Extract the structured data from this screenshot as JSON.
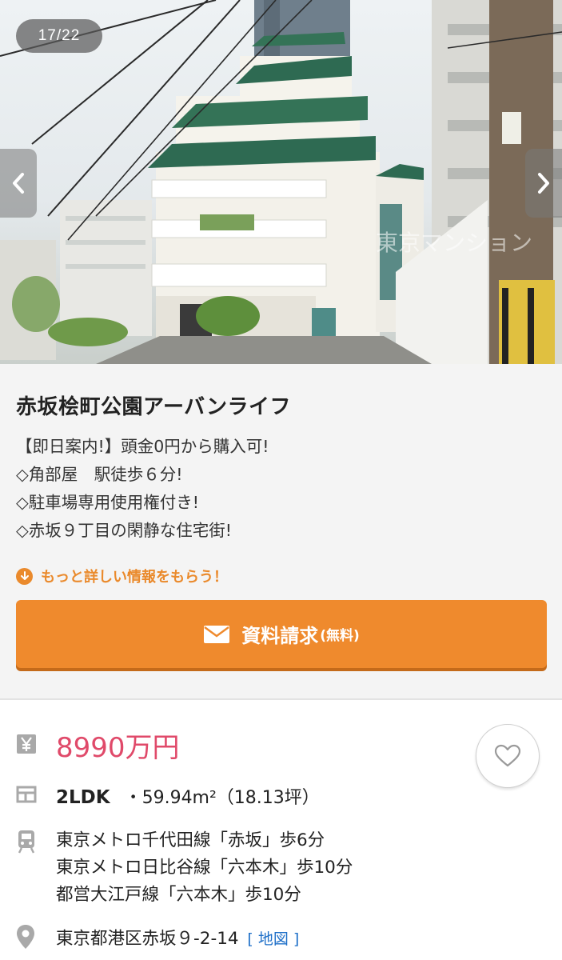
{
  "gallery": {
    "counter": "17/22",
    "watermark": "東京マンション",
    "prev_icon": "chevron-left-icon",
    "next_icon": "chevron-right-icon"
  },
  "listing": {
    "title": "赤坂桧町公園アーバンライフ",
    "description": [
      "【即日案内!】頭金0円から購入可!",
      "◇角部屋　駅徒歩６分!",
      "◇駐車場専用使用権付き!",
      "◇赤坂９丁目の閑静な住宅街!"
    ],
    "more_info_link": "もっと詳しい情報をもらう！",
    "request_button": {
      "label": "資料請求",
      "sub": "(無料)",
      "icon": "mail-icon"
    }
  },
  "details": {
    "price": "8990万円",
    "price_icon": "yen-icon",
    "layout": "2LDK",
    "area": "・59.94m²（18.13坪）",
    "layout_icon": "floorplan-icon",
    "access": [
      "東京メトロ千代田線「赤坂」歩6分",
      "東京メトロ日比谷線「六本木」歩10分",
      "都営大江戸線「六本木」歩10分"
    ],
    "access_icon": "train-icon",
    "address": "東京都港区赤坂９-2-14",
    "map_link": "[ 地図 ]",
    "address_icon": "location-pin-icon",
    "favorite_icon": "heart-icon"
  },
  "colors": {
    "accent_orange": "#ef8a2d",
    "price_pink": "#e04a6a",
    "link_blue": "#1e6fc8",
    "icon_gray": "#a9a9a9"
  }
}
